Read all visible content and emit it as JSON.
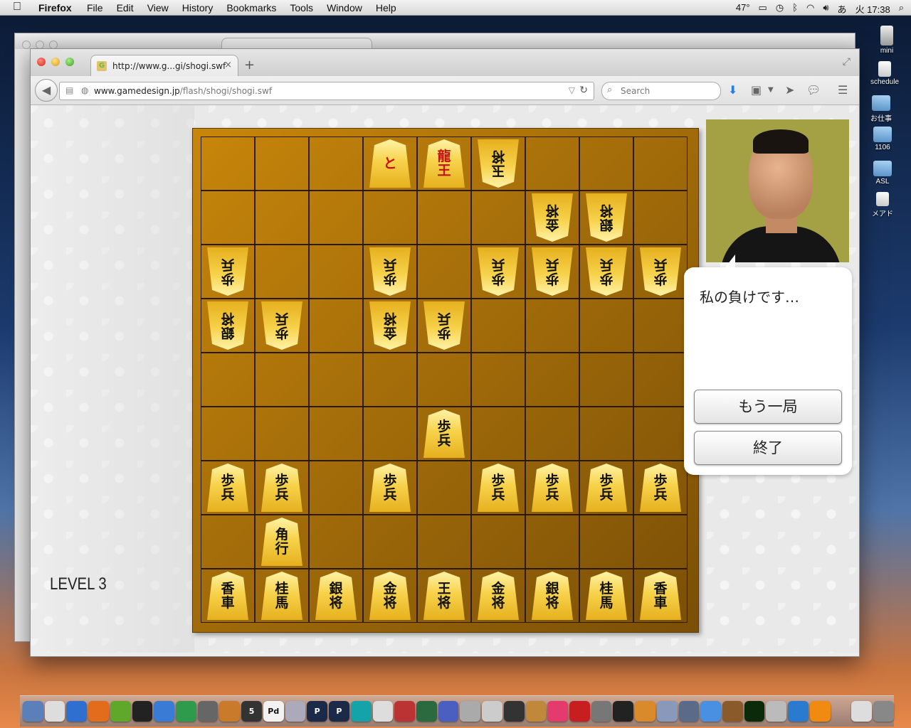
{
  "menubar": {
    "apple": "",
    "app": "Firefox",
    "menus": [
      "File",
      "Edit",
      "View",
      "History",
      "Bookmarks",
      "Tools",
      "Window",
      "Help"
    ],
    "temperature": "47°",
    "input_method": "あ",
    "clock": "火 17:38"
  },
  "browser": {
    "tab_title": "http://www.g...gi/shogi.swf",
    "url_domain": "www.gamedesign.jp",
    "url_path": "/flash/shogi/shogi.swf",
    "search_placeholder": "Search",
    "new_tab": "+",
    "tab_close": "×"
  },
  "game": {
    "level": "LEVEL 3",
    "message": "私の負けです…",
    "buttons": {
      "again": "もう一局",
      "quit": "終了"
    },
    "board": [
      {
        "r": 0,
        "c": 3,
        "t": "と",
        "side": "sente",
        "promo": true
      },
      {
        "r": 0,
        "c": 4,
        "t": "龍王",
        "side": "sente",
        "promo": true
      },
      {
        "r": 0,
        "c": 5,
        "t": "玉将",
        "side": "gote"
      },
      {
        "r": 1,
        "c": 6,
        "t": "金将",
        "side": "gote"
      },
      {
        "r": 1,
        "c": 7,
        "t": "銀将",
        "side": "gote"
      },
      {
        "r": 2,
        "c": 0,
        "t": "歩兵",
        "side": "gote"
      },
      {
        "r": 2,
        "c": 3,
        "t": "歩兵",
        "side": "gote"
      },
      {
        "r": 2,
        "c": 5,
        "t": "歩兵",
        "side": "gote"
      },
      {
        "r": 2,
        "c": 6,
        "t": "歩兵",
        "side": "gote"
      },
      {
        "r": 2,
        "c": 7,
        "t": "歩兵",
        "side": "gote"
      },
      {
        "r": 2,
        "c": 8,
        "t": "歩兵",
        "side": "gote"
      },
      {
        "r": 3,
        "c": 0,
        "t": "銀将",
        "side": "gote"
      },
      {
        "r": 3,
        "c": 1,
        "t": "歩兵",
        "side": "gote"
      },
      {
        "r": 3,
        "c": 3,
        "t": "金将",
        "side": "gote"
      },
      {
        "r": 3,
        "c": 4,
        "t": "歩兵",
        "side": "gote"
      },
      {
        "r": 5,
        "c": 4,
        "t": "歩兵",
        "side": "sente"
      },
      {
        "r": 6,
        "c": 0,
        "t": "歩兵",
        "side": "sente"
      },
      {
        "r": 6,
        "c": 1,
        "t": "歩兵",
        "side": "sente"
      },
      {
        "r": 6,
        "c": 3,
        "t": "歩兵",
        "side": "sente"
      },
      {
        "r": 6,
        "c": 5,
        "t": "歩兵",
        "side": "sente"
      },
      {
        "r": 6,
        "c": 6,
        "t": "歩兵",
        "side": "sente"
      },
      {
        "r": 6,
        "c": 7,
        "t": "歩兵",
        "side": "sente"
      },
      {
        "r": 6,
        "c": 8,
        "t": "歩兵",
        "side": "sente"
      },
      {
        "r": 7,
        "c": 1,
        "t": "角行",
        "side": "sente"
      },
      {
        "r": 8,
        "c": 0,
        "t": "香車",
        "side": "sente"
      },
      {
        "r": 8,
        "c": 1,
        "t": "桂馬",
        "side": "sente"
      },
      {
        "r": 8,
        "c": 2,
        "t": "銀将",
        "side": "sente"
      },
      {
        "r": 8,
        "c": 3,
        "t": "金将",
        "side": "sente"
      },
      {
        "r": 8,
        "c": 4,
        "t": "王将",
        "side": "sente"
      },
      {
        "r": 8,
        "c": 5,
        "t": "金将",
        "side": "sente"
      },
      {
        "r": 8,
        "c": 6,
        "t": "銀将",
        "side": "sente"
      },
      {
        "r": 8,
        "c": 7,
        "t": "桂馬",
        "side": "sente"
      },
      {
        "r": 8,
        "c": 8,
        "t": "香車",
        "side": "sente"
      }
    ]
  },
  "desktop_icons": [
    "mini",
    "schedule",
    "お仕事",
    "1106",
    "ASL",
    "メアド"
  ],
  "dock_labels": [
    "5",
    "Pd",
    "P",
    "P"
  ]
}
